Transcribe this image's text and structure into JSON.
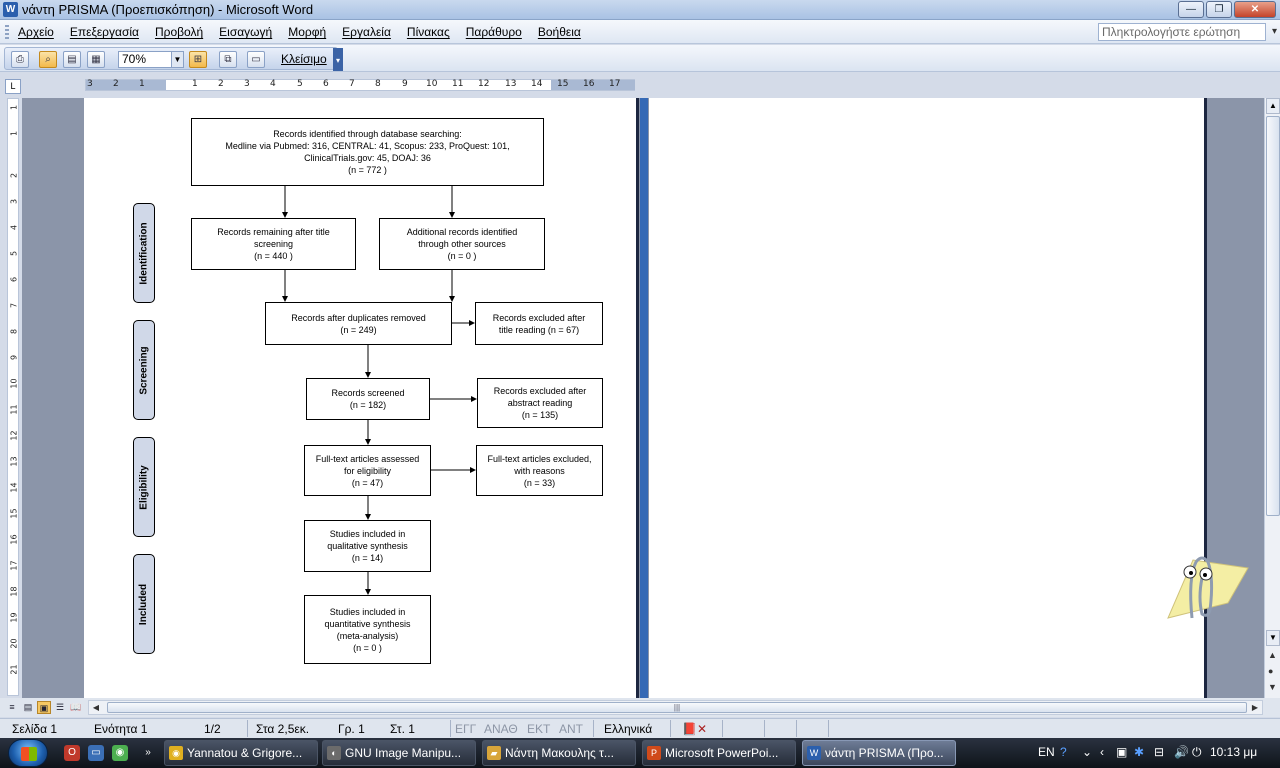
{
  "window": {
    "title": "νάντη PRISMA (Προεπισκόπηση) - Microsoft Word",
    "min_label": "—",
    "max_label": "❐",
    "close_label": "✕"
  },
  "menu": {
    "items": [
      "Αρχείο",
      "Επεξεργασία",
      "Προβολή",
      "Εισαγωγή",
      "Μορφή",
      "Εργαλεία",
      "Πίνακας",
      "Παράθυρο",
      "Βοήθεια"
    ],
    "help_placeholder": "Πληκτρολογήστε ερώτηση"
  },
  "toolbar": {
    "zoom": "70%",
    "close_label": "Κλείσιμο"
  },
  "ruler": {
    "h_labels": [
      "3",
      "2",
      "1",
      "1",
      "2",
      "3",
      "4",
      "5",
      "6",
      "7",
      "8",
      "9",
      "10",
      "11",
      "12",
      "13",
      "14",
      "15",
      "16",
      "17"
    ],
    "v_labels": [
      "1",
      "1",
      "2",
      "3",
      "4",
      "5",
      "6",
      "7",
      "8",
      "9",
      "10",
      "11",
      "12",
      "13",
      "14",
      "15",
      "16",
      "17",
      "18",
      "19",
      "20",
      "21"
    ]
  },
  "flowchart": {
    "phases": [
      "Identification",
      "Screening",
      "Eligibility",
      "Included"
    ],
    "boxes": {
      "db_search": "Records identified through database searching:\nMedline via Pubmed: 316, CENTRAL: 41, Scopus: 233, ProQuest: 101,\nClinicalTrials.gov: 45, DOAJ: 36\n(n = 772 )",
      "after_title": "Records remaining after title\nscreening\n(n = 440 )",
      "other_sources": "Additional records identified\nthrough other sources\n(n = 0 )",
      "after_duplicates": "Records after duplicates removed\n(n = 249)",
      "excluded_title": "Records excluded after\ntitle reading (n = 67)",
      "screened": "Records screened\n(n =  182)",
      "excluded_abstract": "Records excluded after\nabstract reading\n(n =  135)",
      "fulltext": "Full-text articles assessed\nfor eligibility\n(n =  47)",
      "fulltext_excluded": "Full-text articles excluded,\nwith reasons\n(n =  33)",
      "qualitative": "Studies included in\nqualitative synthesis\n(n = 14)",
      "quantitative": "Studies included in\nquantitative synthesis\n(meta-analysis)\n(n = 0  )"
    }
  },
  "status": {
    "page": "Σελίδα  1",
    "section": "Ενότητα  1",
    "pages": "1/2",
    "position": "Στα 2,5εκ.",
    "line": "Γρ.  1",
    "column": "Στ.  1",
    "rec": "ΕΓΓ",
    "trk": "ΑΝΑΘ",
    "ext": "ΕΚΤ",
    "ovr": "ΑΝΤ",
    "language": "Ελληνικά"
  },
  "taskbar": {
    "tasks": [
      "Yannatou & Grigore...",
      "GNU Image Manipu...",
      "Νάντη Μακουλης τ...",
      "Microsoft PowerPoi...",
      "νάντη PRISMA (Προ..."
    ],
    "lang": "EN",
    "time": "10:13 μμ"
  }
}
